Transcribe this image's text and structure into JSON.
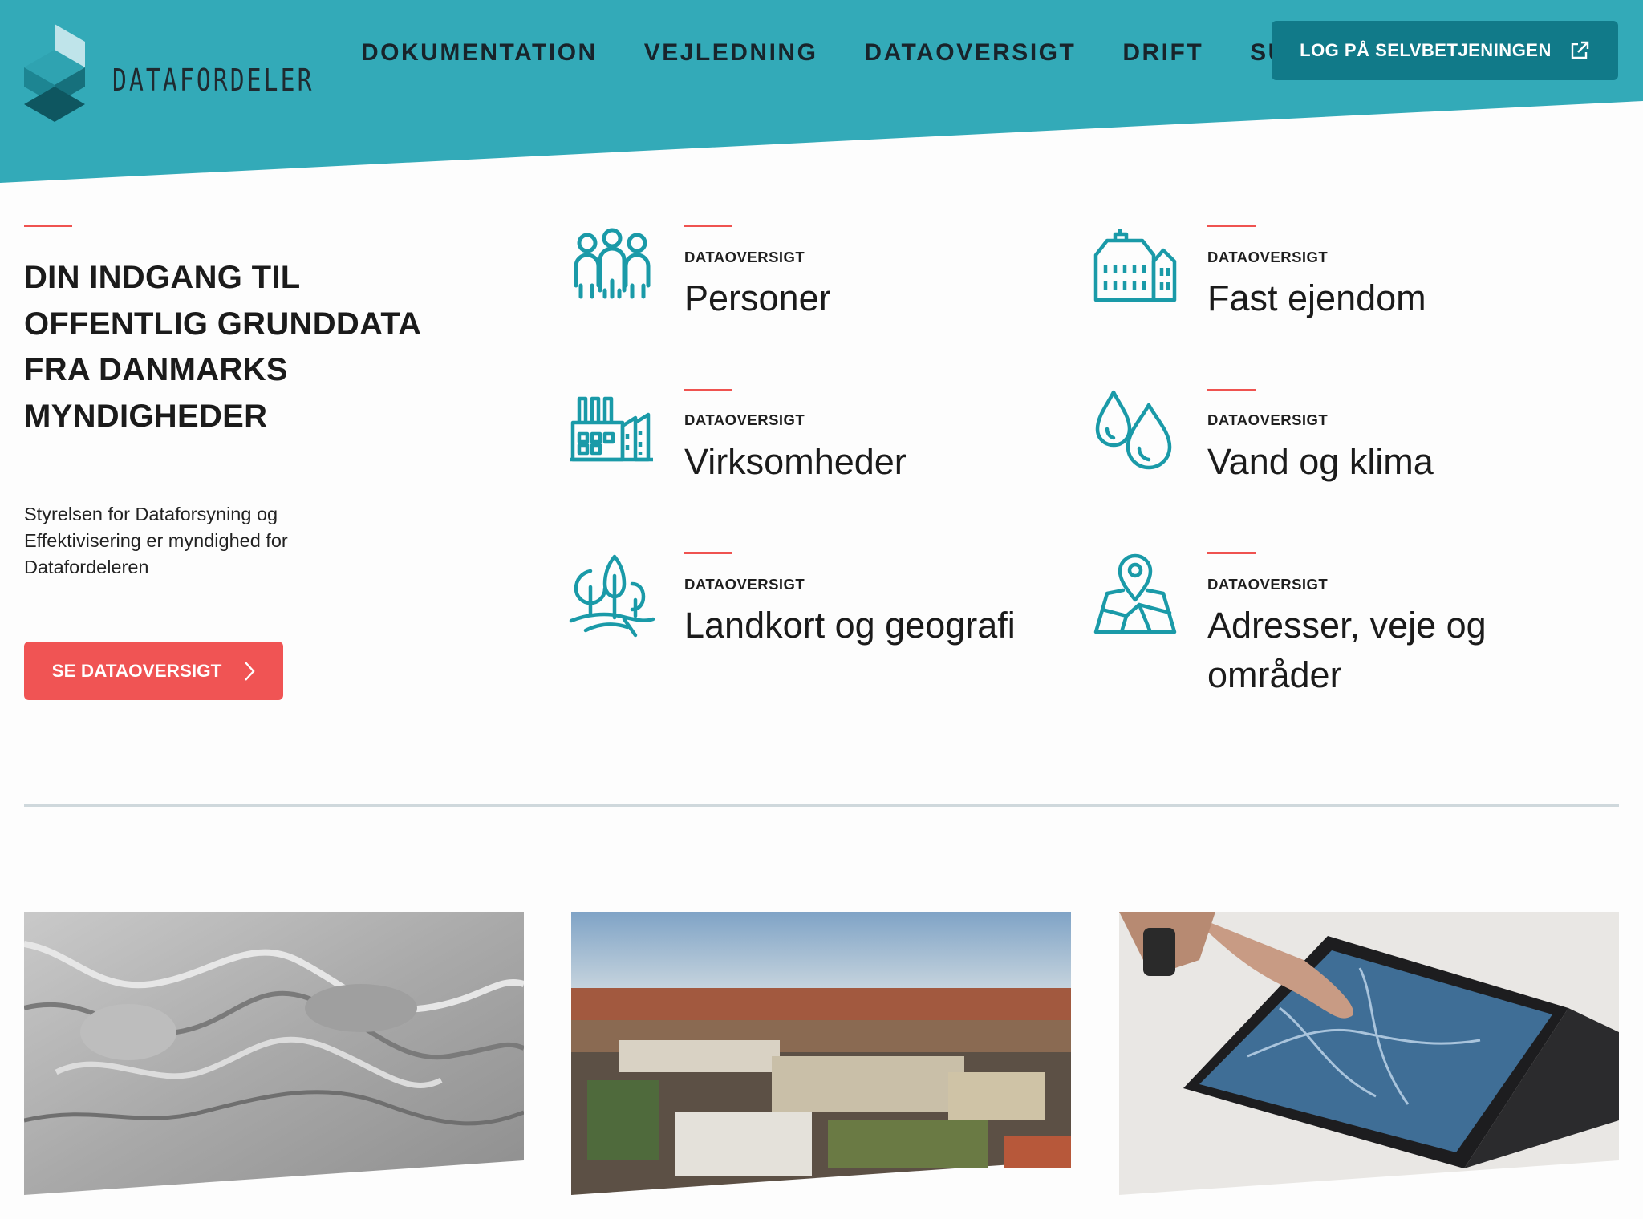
{
  "header": {
    "brand": "DATAFORDELER",
    "nav": [
      "DOKUMENTATION",
      "VEJLEDNING",
      "DATAOVERSIGT",
      "DRIFT",
      "SUPPORT"
    ],
    "login_label": "LOG PÅ SELVBETJENINGEN",
    "colors": {
      "header": "#33aab8",
      "login": "#117a89",
      "accent": "#ef5350",
      "icon": "#1a9aa8"
    }
  },
  "hero": {
    "title": "DIN INDGANG TIL OFFENTLIG GRUNDDATA FRA DANMARKS MYNDIGHEDER",
    "subtitle": "Styrelsen for Dataforsyning og Effektivisering er myndighed for Datafordeleren",
    "cta_label": "SE DATAOVERSIGT"
  },
  "categories": [
    {
      "kicker": "DATAOVERSIGT",
      "title": "Personer",
      "icon": "people-icon"
    },
    {
      "kicker": "DATAOVERSIGT",
      "title": "Fast ejendom",
      "icon": "building-icon"
    },
    {
      "kicker": "DATAOVERSIGT",
      "title": "Virksomheder",
      "icon": "factory-icon"
    },
    {
      "kicker": "DATAOVERSIGT",
      "title": "Vand og klima",
      "icon": "water-drops-icon"
    },
    {
      "kicker": "DATAOVERSIGT",
      "title": "Landkort og geografi",
      "icon": "trees-icon"
    },
    {
      "kicker": "DATAOVERSIGT",
      "title": "Adresser, veje og områder",
      "icon": "map-pin-icon"
    }
  ]
}
